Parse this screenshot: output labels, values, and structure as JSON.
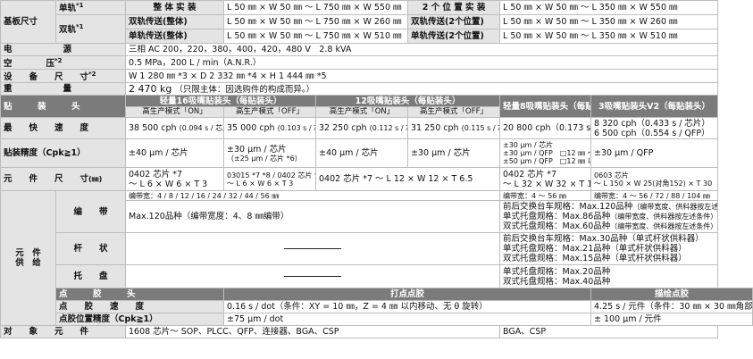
{
  "board": {
    "label": "基板尺寸",
    "single_label": "单轨",
    "single_note": "*1",
    "dual_label": "双轨",
    "dual_note": "*1",
    "r1_a": "整 体 实 装",
    "r1_b": "L 50 ㎜ × W 50 ㎜ ～ L 750 ㎜ × W 550 ㎜",
    "r1_c": "2 个 位 置 实 装",
    "r1_d": "L 50 ㎜ × W 50 ㎜ ～ L 350 ㎜ × W 550 ㎜",
    "r2_a": "双轨传送(整体)",
    "r2_b": "L 50 ㎜ × W 50 ㎜ ～ L 750 ㎜ × W 260 ㎜",
    "r2_c": "双轨传送(2个位置)",
    "r2_d": "L 50 ㎜ × W 50 ㎜ ～ L 350 ㎜ × W 260 ㎜",
    "r3_a": "单轨传送(整体)",
    "r3_b": "L 50 ㎜ × W 50 ㎜ ～ L 750 ㎜ × W 510 ㎜",
    "r3_c": "单轨传送(2个位置)",
    "r3_d": "L 50 ㎜ × W 50 ㎜ ～ L 350 ㎜ × W 510 ㎜"
  },
  "power": {
    "label": "电　　　　　　源",
    "value": "三相 AC 200，220，380，400，420，480 V　2.8 kVA"
  },
  "air": {
    "label": "空　　　　压",
    "note": "*2",
    "value": "0.5 MPa，200 L / min（A.N.R.）"
  },
  "dims": {
    "label": "设　　备　　尺　　寸",
    "note": "*2",
    "value": "W 1 280 ㎜ *3 × D 2 332 ㎜ *4 × H 1 444 ㎜ *5"
  },
  "weight": {
    "label": "重　　　　　　量",
    "value_main": "2 470 kg",
    "value_sub": "（只限主体：因选购件的构成而异。）"
  },
  "head": {
    "label": "贴　　　装　　　头",
    "h16": "轻量16吸嘴贴装头（每贴装头）",
    "h12": "12吸嘴贴装头（每贴装头）",
    "h8": "轻量8吸嘴贴装头（每贴装头）",
    "h3": "3吸嘴贴装头V2（每贴装头）",
    "mode_on": "高生产模式「ON」",
    "mode_off": "高生产模式「OFF」"
  },
  "speed": {
    "label": "最　　快　　速　　度",
    "c16_on": "38 500 cph",
    "c16_on_s": "(0.094 s / 芯片)",
    "c16_off": "35 000 cph",
    "c16_off_s": "(0.103 s / 芯片)",
    "c12_on": "32 250 cph",
    "c12_on_s": "(0.112 s / 芯片)",
    "c12_off": "31 250 cph",
    "c12_off_s": "(0.115 s / 芯片)",
    "c8": "20 800 cph（0.173 s / 芯片）",
    "c3_a": "8 320 cph（0.433 s / 芯片）",
    "c3_b": "6 500 cph（0.554 s / QFP）"
  },
  "accuracy": {
    "label": "贴装精度（Cpk≧1）",
    "c16_on": "±40 μm / 芯片",
    "c16_off_a": "±30 μm / 芯片",
    "c16_off_b": "（±25 μm / 芯片 *6）",
    "c12_on": "±40 μm / 芯片",
    "c12_off": "±30 μm / 芯片",
    "c8_a": "±30 μm / 芯片",
    "c8_b": "±30 μm / QFP　□12 ㎜ ～□32 ㎜",
    "c8_c": "±50 μm / QFP　□12 ㎜ 以下",
    "c3": "±30 μm / QFP"
  },
  "component": {
    "label": "元　　件　　尺　　寸",
    "unit": "(㎜)",
    "c16_on_a": "0402 芯片 *7",
    "c16_on_b": "～ L 6 × W 6 × T 3",
    "c16_off_a": "03015 *7 *8 / 0402 芯片 *7",
    "c16_off_b": "～ L 6 × W 6 × T 3",
    "c12": "0402 芯片 *7 ～ L 12 × W 12 × T 6.5",
    "c8_a": "0402 芯片 *7",
    "c8_b": "～ L 32 × W 32 × T 12",
    "c3_a": "0603 芯片",
    "c3_b": "～ L 150 × W 25(对角152) × T 30"
  },
  "supply": {
    "label_a": "元　件",
    "label_b": "供　给",
    "tape_label": "编　　带",
    "tape_width_left": "编带宽：4 / 8 / 12 / 16 / 24 / 32 / 44 / 56 ㎜",
    "tape_width_mid": "编带宽：4 ～ 56 ㎜",
    "tape_width_right": "编带宽：4 ～ 56 / 72 / 88 / 104 ㎜",
    "tape_left": "Max.120品种（编带宽度：4、8 ㎜编带）",
    "tape_r1": "前后交换台车规格：Max.120品种",
    "tape_r1_n": "（编带宽度、供料器按左述条件）",
    "tape_r2": "单式托盘规格：Max.86品种",
    "tape_r2_n": "（编带宽度、供料器按左述条件）",
    "tape_r3": "双式托盘规格：Max.60品种",
    "tape_r3_n": "（编带宽度、供料器按左述条件）",
    "stick_label": "杆　　状",
    "stick_r1": "前后交换台车规格：Max.30品种（单式杆状供料器）",
    "stick_r2": "单式托盘规格：Max.21品种（单式杆状供料器）",
    "stick_r3": "双式托盘规格：Max.15品种（单式杆状供料器）",
    "tray_label": "托　　盘",
    "tray_r1": "单式托盘规格：Max.20品种",
    "tray_r2": "双式托盘规格：Max.40品种"
  },
  "dispense": {
    "head_label": "点　　　胶　　　头",
    "dot_head": "打点点胶",
    "draw_head": "描绘点胶",
    "speed_label": "点　　胶　　速　　度",
    "dot_speed": "0.16 s / dot（条件：XY = 10 ㎜，Z = 4 ㎜ 以内移动、无 θ 旋转）",
    "draw_speed": "4.25 s / 元件（条件：30 ㎜ × 30 ㎜角部点胶）*9",
    "acc_label": "点胶位置精度（Cpk≧1）",
    "dot_acc": "±75 μm / dot",
    "draw_acc": "± 100 μm / 元件",
    "target_label": "对　　象　　元　　件",
    "dot_target": "1608 芯片～ SOP、PLCC、QFP、连接器、BGA、CSP",
    "draw_target": "BGA、CSP"
  }
}
